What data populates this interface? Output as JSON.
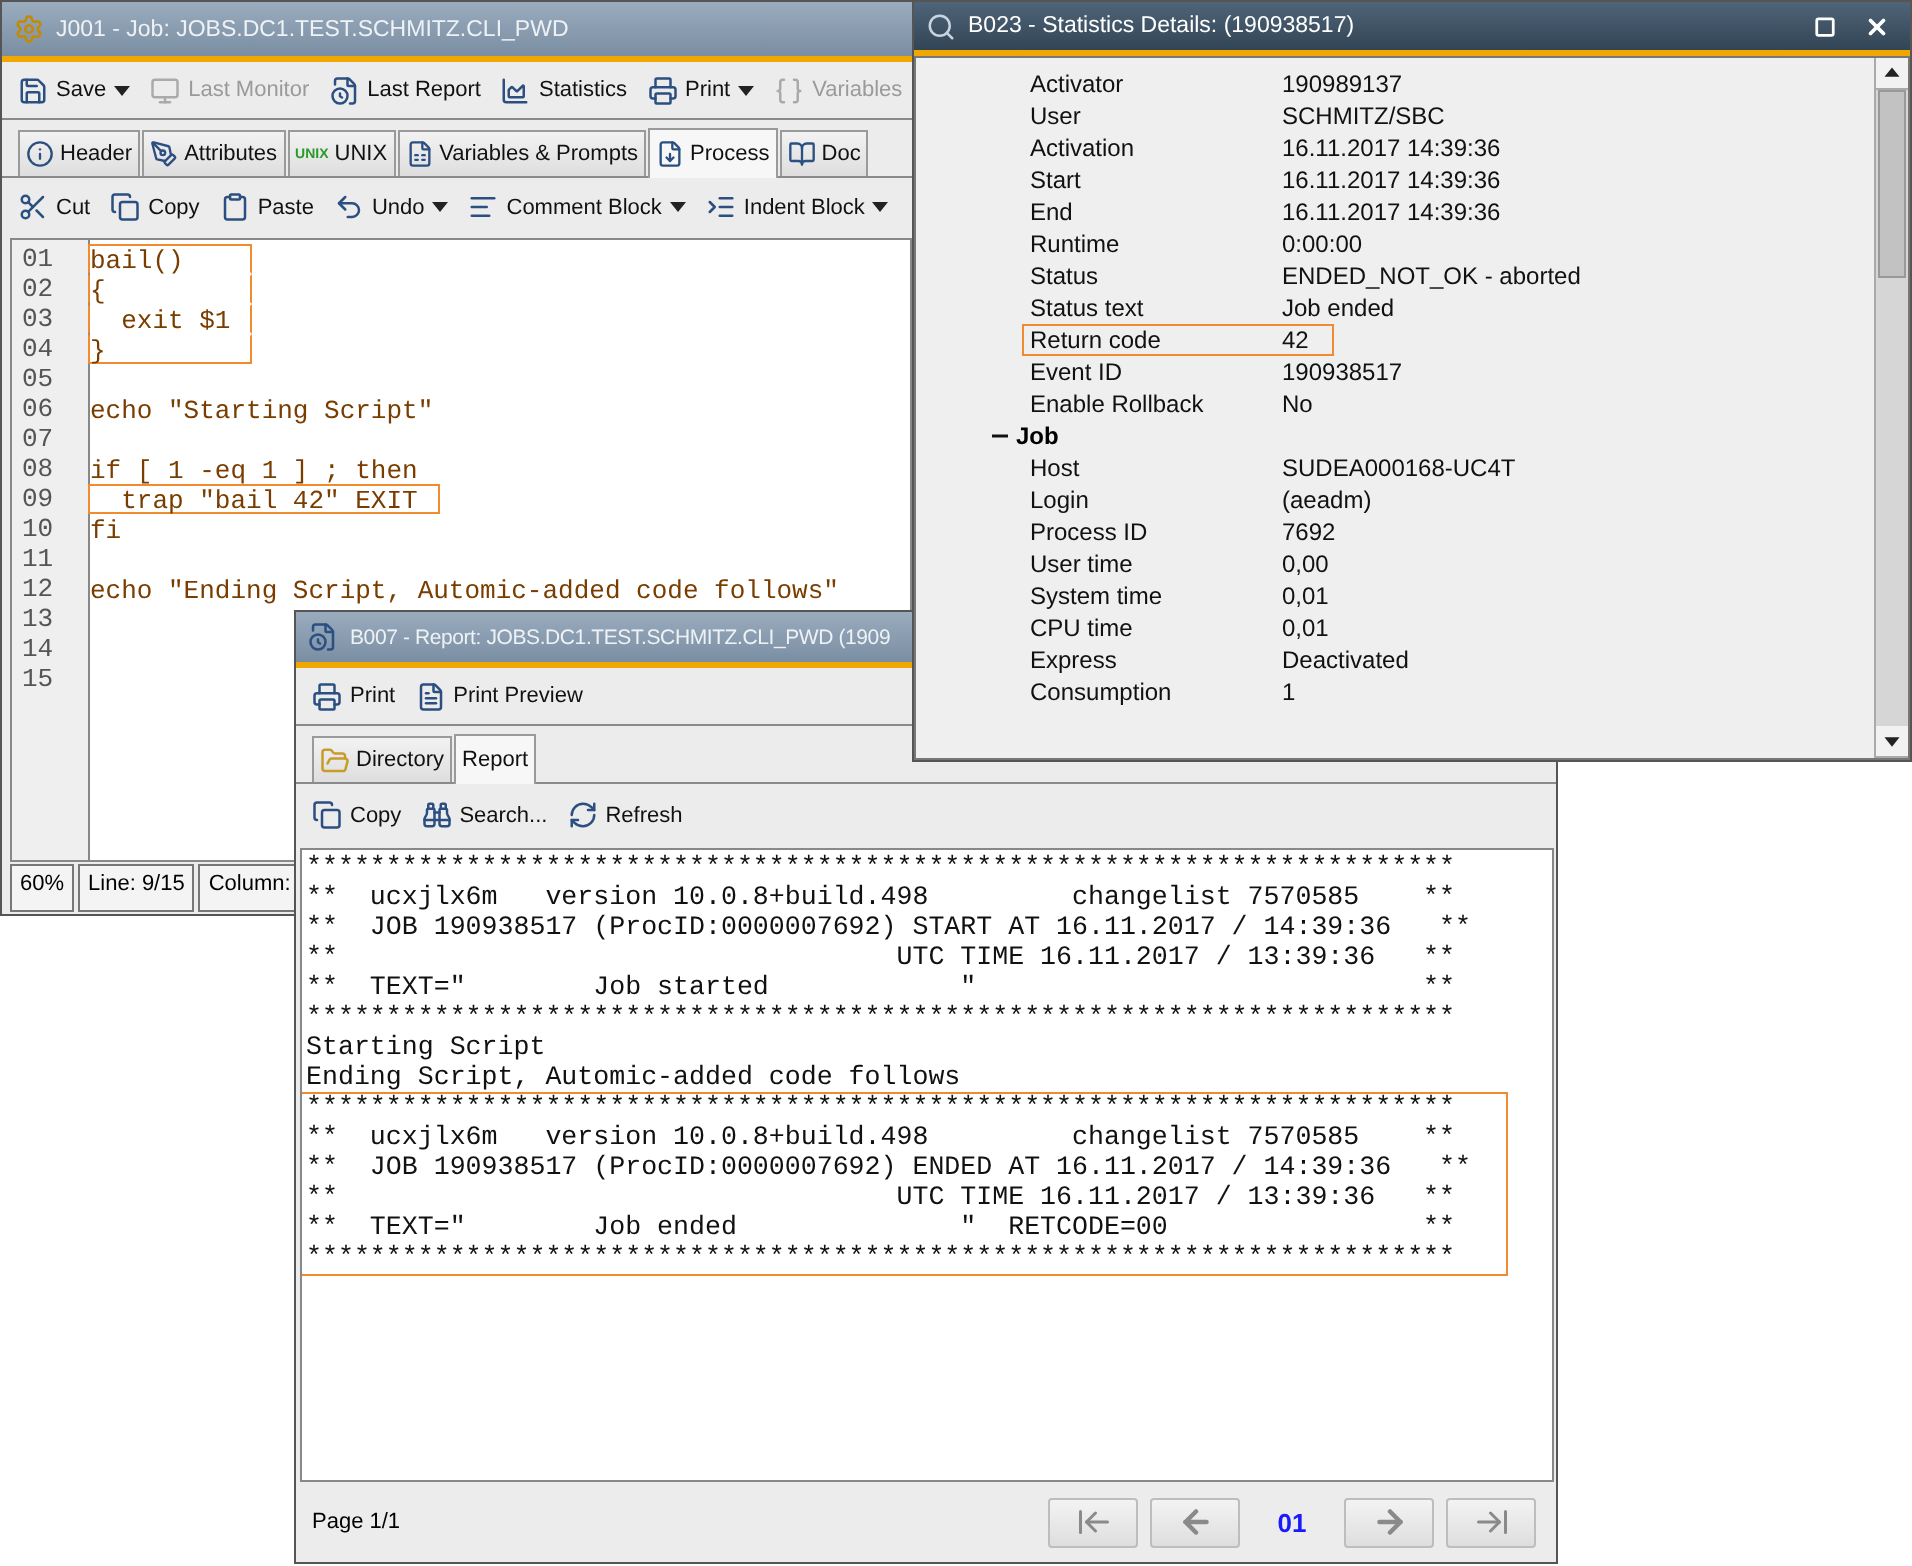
{
  "job_window": {
    "title": "J001 - Job: JOBS.DC1.TEST.SCHMITZ.CLI_PWD",
    "toolbar": [
      {
        "label": "Save",
        "disabled": false,
        "dropdown": true
      },
      {
        "label": "Last Monitor",
        "disabled": true,
        "dropdown": false
      },
      {
        "label": "Last Report",
        "disabled": false,
        "dropdown": false
      },
      {
        "label": "Statistics",
        "disabled": false,
        "dropdown": false
      },
      {
        "label": "Print",
        "disabled": false,
        "dropdown": true
      },
      {
        "label": "Variables",
        "disabled": true,
        "dropdown": false
      }
    ],
    "tabs": [
      {
        "label": "Header",
        "selected": false
      },
      {
        "label": "Attributes",
        "selected": false
      },
      {
        "label": "UNIX",
        "selected": false
      },
      {
        "label": "Variables & Prompts",
        "selected": false
      },
      {
        "label": "Process",
        "selected": true
      },
      {
        "label": "Doc",
        "selected": false
      }
    ],
    "unix_badge": "UNIX",
    "edit_toolbar": [
      {
        "label": "Cut",
        "dropdown": false
      },
      {
        "label": "Copy",
        "dropdown": false
      },
      {
        "label": "Paste",
        "dropdown": false
      },
      {
        "label": "Undo",
        "dropdown": true
      },
      {
        "label": "Comment Block",
        "dropdown": true
      },
      {
        "label": "Indent Block",
        "dropdown": true
      }
    ],
    "code_lines": [
      {
        "number": "01",
        "text": "bail()",
        "highlighted": true
      },
      {
        "number": "02",
        "text": "{",
        "highlighted": true
      },
      {
        "number": "03",
        "text": "  exit $1",
        "highlighted": true
      },
      {
        "number": "04",
        "text": "}",
        "highlighted": true
      },
      {
        "number": "05",
        "highlighted": false
      },
      {
        "number": "06",
        "text": "echo \"Starting Script\"",
        "highlighted": false
      },
      {
        "number": "07",
        "highlighted": false
      },
      {
        "number": "08",
        "text": "if [ 1 -eq 1 ] ; then",
        "highlighted": false
      },
      {
        "number": "09",
        "text": "  trap \"bail 42\" EXIT",
        "highlighted": true
      },
      {
        "number": "10",
        "text": "fi",
        "highlighted": false
      },
      {
        "number": "11",
        "highlighted": false
      },
      {
        "number": "12",
        "text": "echo \"Ending Script, Automic-added code follows\"",
        "highlighted": false
      },
      {
        "number": "13",
        "highlighted": false
      },
      {
        "number": "14",
        "highlighted": false
      },
      {
        "number": "15",
        "highlighted": false
      }
    ],
    "status": [
      "60%",
      "Line: 9/15",
      "Column:"
    ]
  },
  "report_window": {
    "title": "B007 - Report: JOBS.DC1.TEST.SCHMITZ.CLI_PWD (1909",
    "toolbar": [
      "Print",
      "Print Preview"
    ],
    "tabs": [
      {
        "label": "Directory",
        "selected": false
      },
      {
        "label": "Report",
        "selected": true
      }
    ],
    "actions": [
      "Copy",
      "Search...",
      "Refresh"
    ],
    "report_lines": [
      {
        "text": "************************************************************************",
        "highlighted": false
      },
      {
        "text": "**  ucxjlx6m   version 10.0.8+build.498         changelist 7570585    **",
        "highlighted": false
      },
      {
        "text": "**  JOB 190938517 (ProcID:0000007692) START AT 16.11.2017 / 14:39:36   **",
        "highlighted": false
      },
      {
        "text": "**                                   UTC TIME 16.11.2017 / 13:39:36   **",
        "highlighted": false
      },
      {
        "text": "**  TEXT=\"        Job started            \"                            **",
        "highlighted": false
      },
      {
        "text": "************************************************************************",
        "highlighted": false
      },
      {
        "text": "Starting Script",
        "highlighted": false
      },
      {
        "text": "Ending Script, Automic-added code follows",
        "highlighted": false
      },
      {
        "text": "************************************************************************",
        "highlighted": true
      },
      {
        "text": "**  ucxjlx6m   version 10.0.8+build.498         changelist 7570585    **",
        "highlighted": true
      },
      {
        "text": "**  JOB 190938517 (ProcID:0000007692) ENDED AT 16.11.2017 / 14:39:36   **",
        "highlighted": true
      },
      {
        "text": "**                                   UTC TIME 16.11.2017 / 13:39:36   **",
        "highlighted": true
      },
      {
        "text": "**  TEXT=\"        Job ended              \"  RETCODE=00                **",
        "highlighted": true
      },
      {
        "text": "************************************************************************",
        "highlighted": true
      }
    ],
    "page_label": "Page 1/1",
    "page_number": "01"
  },
  "stats_window": {
    "title": "B023 - Statistics Details: (190938517)",
    "rows": [
      {
        "label": "Activator",
        "value": "190989137",
        "highlighted": false
      },
      {
        "label": "User",
        "value": "SCHMITZ/SBC",
        "highlighted": false
      },
      {
        "label": "Activation",
        "value": "16.11.2017 14:39:36",
        "highlighted": false
      },
      {
        "label": "Start",
        "value": "16.11.2017 14:39:36",
        "highlighted": false
      },
      {
        "label": "End",
        "value": "16.11.2017 14:39:36",
        "highlighted": false
      },
      {
        "label": "Runtime",
        "value": "0:00:00",
        "highlighted": false
      },
      {
        "label": "Status",
        "value": "ENDED_NOT_OK - aborted",
        "highlighted": false
      },
      {
        "label": "Status text",
        "value": "Job ended",
        "highlighted": false
      },
      {
        "label": "Return code",
        "value": "42",
        "highlighted": true
      },
      {
        "label": "Event ID",
        "value": "190938517",
        "highlighted": false
      },
      {
        "label": "Enable Rollback",
        "value": "No",
        "highlighted": false
      }
    ],
    "job_section": {
      "title": "Job",
      "expanded": true,
      "rows": [
        {
          "label": "Host",
          "value": "SUDEA000168-UC4T",
          "highlighted": false
        },
        {
          "label": "Login",
          "value": "(aeadm)",
          "highlighted": false
        },
        {
          "label": "Process ID",
          "value": "7692",
          "highlighted": false
        },
        {
          "label": "User time",
          "value": "0,00",
          "highlighted": false
        },
        {
          "label": "System time",
          "value": "0,01",
          "highlighted": false
        },
        {
          "label": "CPU time",
          "value": "0,01",
          "highlighted": false
        },
        {
          "label": "Express",
          "value": "Deactivated",
          "highlighted": false
        },
        {
          "label": "Consumption",
          "value": "1",
          "highlighted": false
        }
      ]
    }
  }
}
